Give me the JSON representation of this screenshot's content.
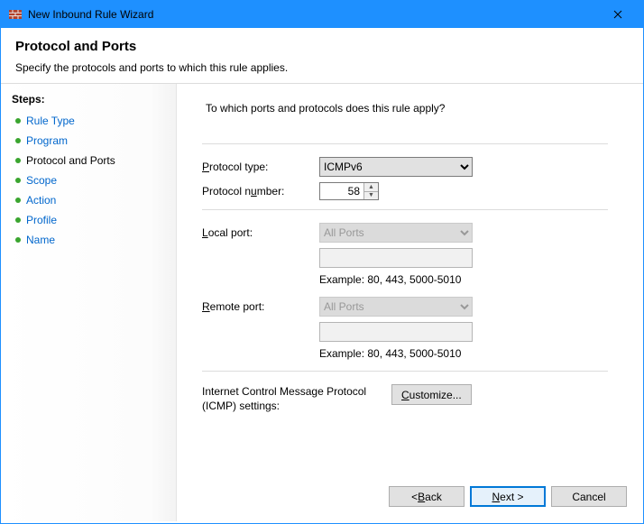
{
  "window": {
    "title": "New Inbound Rule Wizard"
  },
  "header": {
    "title": "Protocol and Ports",
    "subtitle": "Specify the protocols and ports to which this rule applies."
  },
  "sidebar": {
    "heading": "Steps:",
    "items": [
      {
        "label": "Rule Type",
        "current": false
      },
      {
        "label": "Program",
        "current": false
      },
      {
        "label": "Protocol and Ports",
        "current": true
      },
      {
        "label": "Scope",
        "current": false
      },
      {
        "label": "Action",
        "current": false
      },
      {
        "label": "Profile",
        "current": false
      },
      {
        "label": "Name",
        "current": false
      }
    ]
  },
  "content": {
    "question": "To which ports and protocols does this rule apply?",
    "protocol_type_label_pre": "P",
    "protocol_type_label_rest": "rotocol type:",
    "protocol_type_value": "ICMPv6",
    "protocol_number_label_pre": "Protocol n",
    "protocol_number_label_u": "u",
    "protocol_number_label_rest": "mber:",
    "protocol_number_value": "58",
    "local_port_label_u": "L",
    "local_port_label_rest": "ocal port:",
    "local_port_value": "All Ports",
    "local_port_text": "",
    "local_example": "Example: 80, 443, 5000-5010",
    "remote_port_label_u": "R",
    "remote_port_label_rest": "emote port:",
    "remote_port_value": "All Ports",
    "remote_port_text": "",
    "remote_example": "Example: 80, 443, 5000-5010",
    "icmp_label": "Internet Control Message Protocol (ICMP) settings:",
    "customize_u": "C",
    "customize_rest": "ustomize..."
  },
  "footer": {
    "back_prefix": "< ",
    "back_u": "B",
    "back_rest": "ack",
    "next_u": "N",
    "next_rest": "ext >",
    "cancel": "Cancel"
  }
}
